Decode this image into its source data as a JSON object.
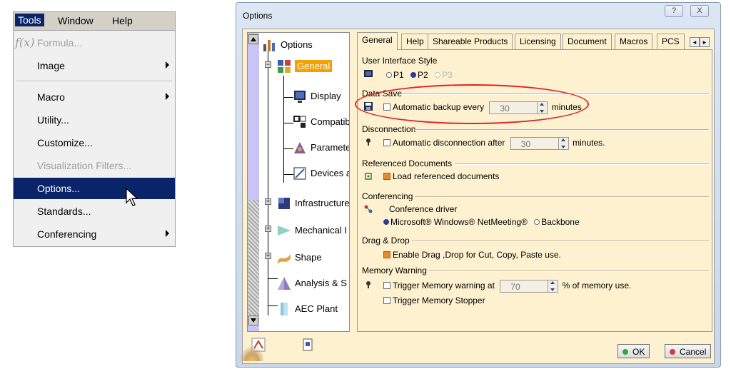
{
  "menu": {
    "bar": [
      "Tools",
      "Window",
      "Help"
    ],
    "items": [
      {
        "label": "Formula...",
        "disabled": true,
        "submenu": false,
        "icon": "formula-icon"
      },
      {
        "label": "Image",
        "disabled": false,
        "submenu": true
      },
      {
        "label": "Macro",
        "disabled": false,
        "submenu": true
      },
      {
        "label": "Utility...",
        "disabled": false,
        "submenu": false
      },
      {
        "label": "Customize...",
        "disabled": false,
        "submenu": false
      },
      {
        "label": "Visualization Filters...",
        "disabled": true,
        "submenu": false
      },
      {
        "label": "Options...",
        "disabled": false,
        "submenu": false,
        "selected": true
      },
      {
        "label": "Standards...",
        "disabled": false,
        "submenu": false
      },
      {
        "label": "Conferencing",
        "disabled": false,
        "submenu": true
      }
    ],
    "selection_color": "#0a246a"
  },
  "dialog": {
    "title": "Options",
    "help_button": "?",
    "close_button": "X",
    "tree": {
      "root": "Options",
      "items": [
        {
          "label": "General",
          "selected": true,
          "icon": "general-icon"
        },
        {
          "label": "Display",
          "icon": "display-icon"
        },
        {
          "label": "Compatib",
          "icon": "compatibility-icon"
        },
        {
          "label": "Paramete",
          "icon": "parameters-icon"
        },
        {
          "label": "Devices a",
          "icon": "devices-icon"
        },
        {
          "label": "Infrastructure",
          "icon": "infrastructure-icon"
        },
        {
          "label": "Mechanical I",
          "icon": "mechanical-icon"
        },
        {
          "label": "Shape",
          "icon": "shape-icon"
        },
        {
          "label": "Analysis & S",
          "icon": "analysis-icon"
        },
        {
          "label": "AEC Plant",
          "icon": "aec-plant-icon"
        }
      ]
    },
    "tabs": [
      "General",
      "Help",
      "Shareable Products",
      "Licensing",
      "Document",
      "Macros",
      "PCS"
    ],
    "active_tab": "General",
    "sections": {
      "ui_style": {
        "title": "User Interface Style",
        "options": [
          "P1",
          "P2",
          "P3"
        ],
        "selected": "P2"
      },
      "data_save": {
        "title": "Data Save",
        "label": "Automatic backup every",
        "value": "30",
        "unit": "minutes"
      },
      "disconnection": {
        "title": "Disconnection",
        "label": "Automatic disconnection after",
        "value": "30",
        "unit": "minutes."
      },
      "referenced": {
        "title": "Referenced Documents",
        "label": "Load referenced documents"
      },
      "conferencing": {
        "title": "Conferencing",
        "driver_label": "Conference driver",
        "options": [
          "Microsoft® Windows® NetMeeting®",
          "Backbone"
        ]
      },
      "dragdrop": {
        "title": "Drag & Drop",
        "label": "Enable Drag ,Drop for Cut, Copy, Paste use."
      },
      "memory": {
        "title": "Memory Warning",
        "label": "Trigger Memory warning at",
        "value": "70",
        "unit": "% of memory use.",
        "stopper_label": "Trigger Memory Stopper"
      }
    },
    "ok_label": "OK",
    "cancel_label": "Cancel",
    "highlight_color": "#e0232b",
    "accent_color": "#f4a000"
  }
}
